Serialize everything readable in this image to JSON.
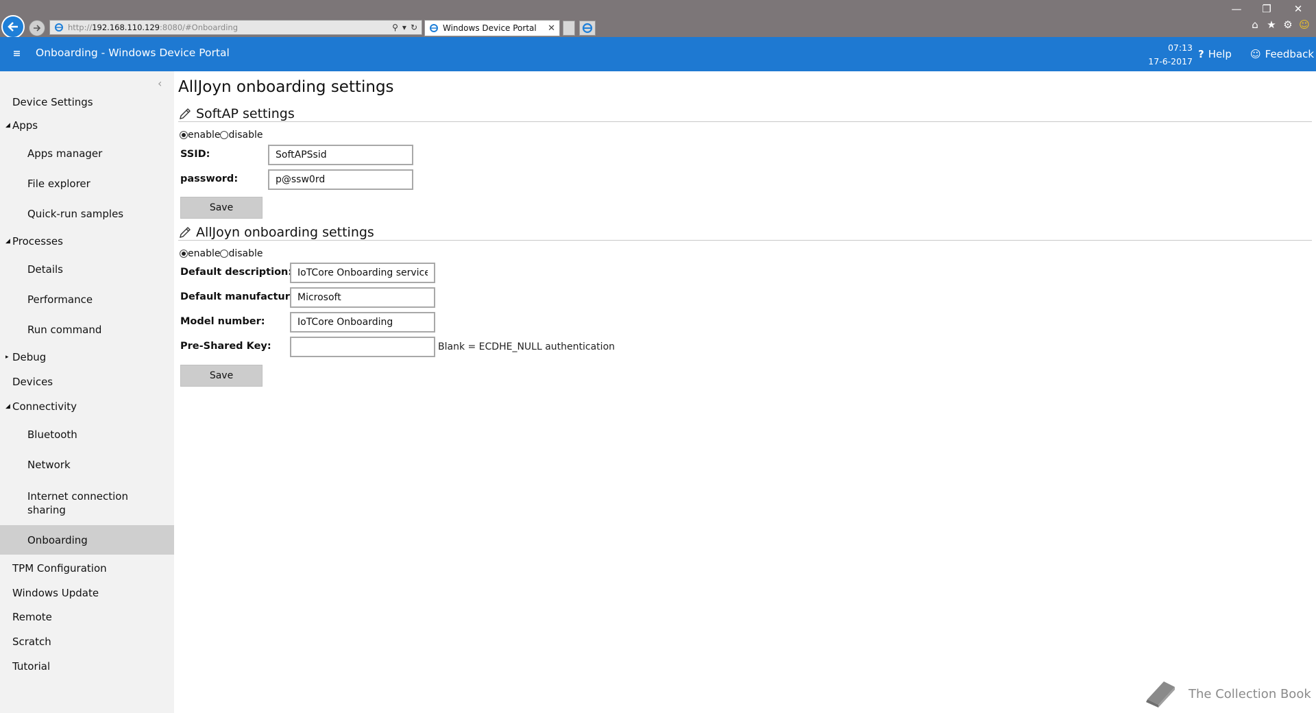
{
  "browser": {
    "address": {
      "prefix": "http://",
      "host": "192.168.110.129",
      "suffix": ":8080/#Onboarding"
    },
    "tab_title": "Windows Device Portal"
  },
  "header": {
    "title": "Onboarding - Windows Device Portal",
    "time": "07:13",
    "date": "17-6-2017",
    "help_label": "Help",
    "feedback_label": "Feedback",
    "color": "#1e79d2"
  },
  "sidebar": {
    "items": [
      {
        "label": "Device Settings"
      },
      {
        "label": "Apps"
      },
      {
        "label": "Apps manager"
      },
      {
        "label": "File explorer"
      },
      {
        "label": "Quick-run samples"
      },
      {
        "label": "Processes"
      },
      {
        "label": "Details"
      },
      {
        "label": "Performance"
      },
      {
        "label": "Run command"
      },
      {
        "label": "Debug"
      },
      {
        "label": "Devices"
      },
      {
        "label": "Connectivity"
      },
      {
        "label": "Bluetooth"
      },
      {
        "label": "Network"
      },
      {
        "label": "Internet connection sharing"
      },
      {
        "label": "Onboarding",
        "active": true
      },
      {
        "label": "TPM Configuration"
      },
      {
        "label": "Windows Update"
      },
      {
        "label": "Remote"
      },
      {
        "label": "Scratch"
      },
      {
        "label": "Tutorial"
      }
    ]
  },
  "main": {
    "title": "AllJoyn onboarding settings",
    "softap": {
      "header": "SoftAP settings",
      "enable_label": "enable",
      "disable_label": "disable",
      "ssid_label": "SSID:",
      "ssid_value": "SoftAPSsid",
      "password_label": "password:",
      "password_value": "p@ssw0rd",
      "save_label": "Save"
    },
    "alljoyn": {
      "header": "AllJoyn onboarding settings",
      "enable_label": "enable",
      "disable_label": "disable",
      "description_label": "Default description:",
      "description_value": "IoTCore Onboarding service",
      "manufacturer_label": "Default manufacturer:",
      "manufacturer_value": "Microsoft",
      "model_label": "Model number:",
      "model_value": "IoTCore Onboarding",
      "psk_label": "Pre-Shared Key:",
      "psk_value": "",
      "psk_hint": "Blank = ECDHE_NULL authentication",
      "save_label": "Save"
    }
  },
  "watermark": {
    "text": "The Collection Book"
  }
}
